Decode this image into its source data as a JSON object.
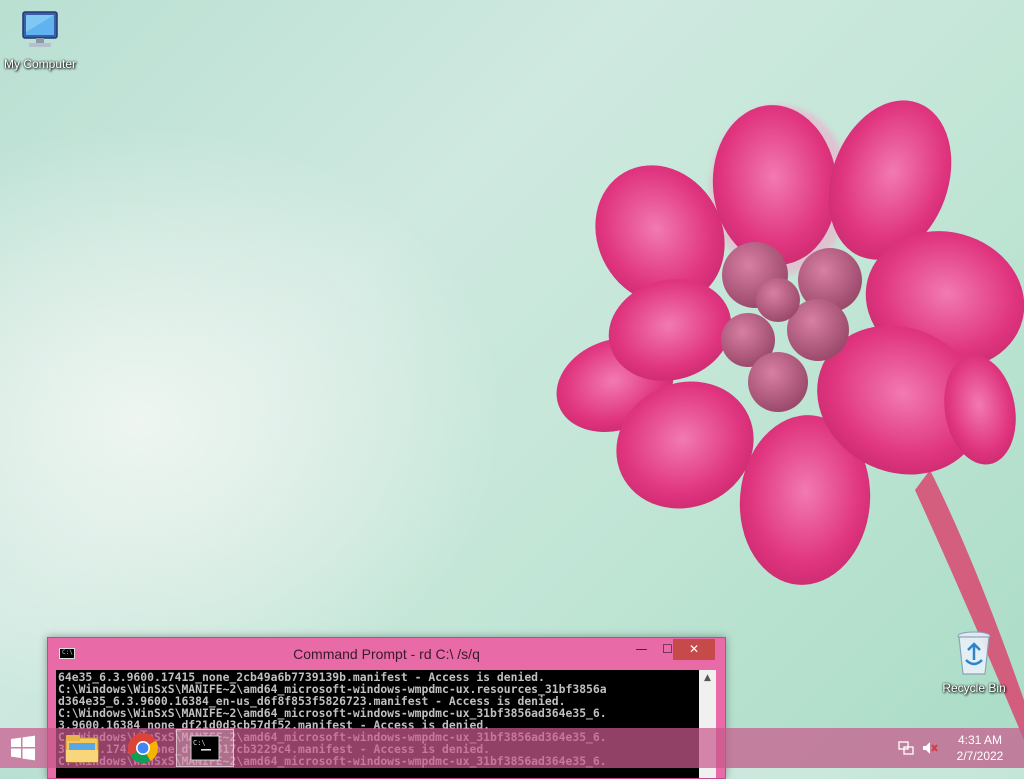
{
  "desktop": {
    "icons": [
      {
        "label": "My Computer",
        "icon": "computer-icon"
      },
      {
        "label": "Recycle Bin",
        "icon": "recycle-bin-icon"
      }
    ]
  },
  "cmd_window": {
    "title": "Command Prompt - rd  C:\\ /s/q",
    "buttons": {
      "minimize": "—",
      "maximize": "☐",
      "close": "✕"
    },
    "console_lines": [
      "64e35_6.3.9600.17415_none_2cb49a6b7739139b.manifest - Access is denied.",
      "C:\\Windows\\WinSxS\\MANIFE~2\\amd64_microsoft-windows-wmpdmc-ux.resources_31bf3856a",
      "d364e35_6.3.9600.16384_en-us_d6f8f853f5826723.manifest - Access is denied.",
      "C:\\Windows\\WinSxS\\MANIFE~2\\amd64_microsoft-windows-wmpdmc-ux_31bf3856ad364e35_6.",
      "3.9600.16384_none_df21d0d3cb57df52.manifest - Access is denied.",
      "C:\\Windows\\WinSxS\\MANIFE~2\\amd64_microsoft-windows-wmpdmc-ux_31bf3856ad364e35_6.",
      "3.9600.17415_none_dfc4c317cb3229c4.manifest - Access is denied.",
      "C:\\Windows\\WinSxS\\MANIFE~2\\amd64_microsoft-windows-wmpdmc-ux_31bf3856ad364e35_6."
    ],
    "scroll_up": "▲"
  },
  "taskbar": {
    "apps": [
      {
        "name": "File Explorer",
        "icon": "folder-icon"
      },
      {
        "name": "Google Chrome",
        "icon": "chrome-icon"
      },
      {
        "name": "Command Prompt",
        "icon": "cmd-icon"
      }
    ],
    "tray": {
      "network_icon": "network-icon",
      "volume_icon": "volume-muted-icon"
    },
    "clock": {
      "time": "4:31 AM",
      "date": "2/7/2022"
    }
  },
  "colors": {
    "accent": "#e86aa6",
    "close_button": "#c74a4a",
    "flower": "#e23d86"
  }
}
